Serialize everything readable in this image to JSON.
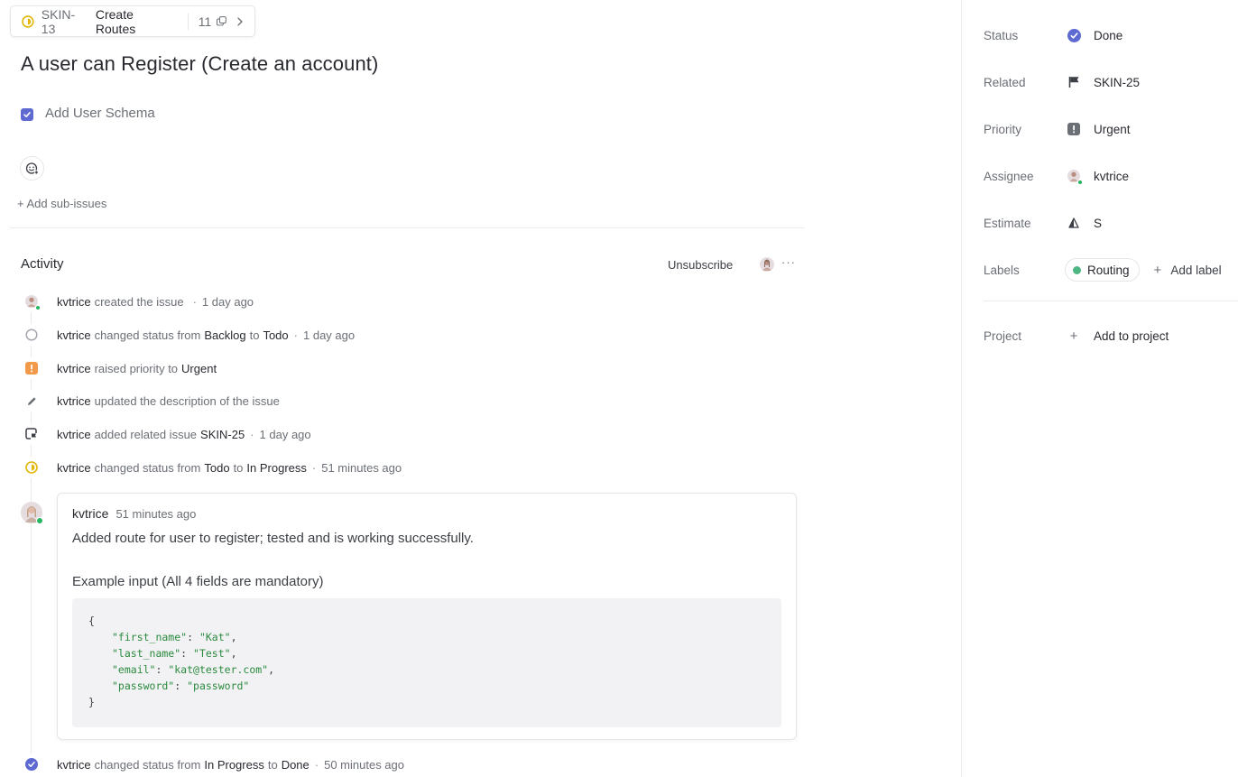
{
  "parent": {
    "id": "SKIN-13",
    "title": "Create Routes",
    "sub_count": "11"
  },
  "issue": {
    "title": "A user can Register (Create an account)",
    "todo_text": "Add User Schema",
    "add_sub_issues": "+ Add sub-issues"
  },
  "activity": {
    "heading": "Activity",
    "unsubscribe": "Unsubscribe",
    "more": "···",
    "items": [
      {
        "who": "kvtrice",
        "text": "created the issue",
        "time": "1 day ago"
      },
      {
        "who": "kvtrice",
        "text": "changed status from",
        "from": "Backlog",
        "to_word": "to",
        "to": "Todo",
        "time": "1 day ago"
      },
      {
        "who": "kvtrice",
        "text": "raised priority to",
        "to": "Urgent"
      },
      {
        "who": "kvtrice",
        "text": "updated the description of the issue"
      },
      {
        "who": "kvtrice",
        "text": "added related issue",
        "to": "SKIN-25",
        "time": "1 day ago"
      },
      {
        "who": "kvtrice",
        "text": "changed status from",
        "from": "Todo",
        "to_word": "to",
        "to": "In Progress",
        "time": "51 minutes ago"
      },
      {
        "who": "kvtrice",
        "text": "changed status from",
        "from": "In Progress",
        "to_word": "to",
        "to": "Done",
        "time": "50 minutes ago"
      }
    ],
    "dot": "·"
  },
  "comment": {
    "author": "kvtrice",
    "time": "51 minutes ago",
    "line1": "Added route for user to register; tested and is working successfully.",
    "line2": "Example input (All 4 fields are mandatory)",
    "code": {
      "open": "{",
      "close": "}",
      "lines": [
        {
          "key": "\"first_name\"",
          "value": "\"Kat\"",
          "sep": ": ",
          "end": ","
        },
        {
          "key": "\"last_name\"",
          "value": "\"Test\"",
          "sep": ": ",
          "end": ","
        },
        {
          "key": "\"email\"",
          "value": "\"kat@tester.com\"",
          "sep": ": ",
          "end": ","
        },
        {
          "key": "\"password\"",
          "value": "\"password\"",
          "sep": ": ",
          "end": ""
        }
      ]
    }
  },
  "properties": {
    "status": {
      "label": "Status",
      "value": "Done"
    },
    "related": {
      "label": "Related",
      "value": "SKIN-25"
    },
    "priority": {
      "label": "Priority",
      "value": "Urgent"
    },
    "assignee": {
      "label": "Assignee",
      "value": "kvtrice"
    },
    "estimate": {
      "label": "Estimate",
      "value": "S"
    },
    "labels": {
      "label": "Labels",
      "value": "Routing",
      "add": "Add label"
    },
    "project": {
      "label": "Project",
      "value": "Add to project"
    }
  },
  "colors": {
    "accent": "#5e6ad2",
    "in_progress": "#f2c94c",
    "urgent": "#f2994a",
    "label_routing": "#4cb782",
    "presence": "#26b561"
  }
}
